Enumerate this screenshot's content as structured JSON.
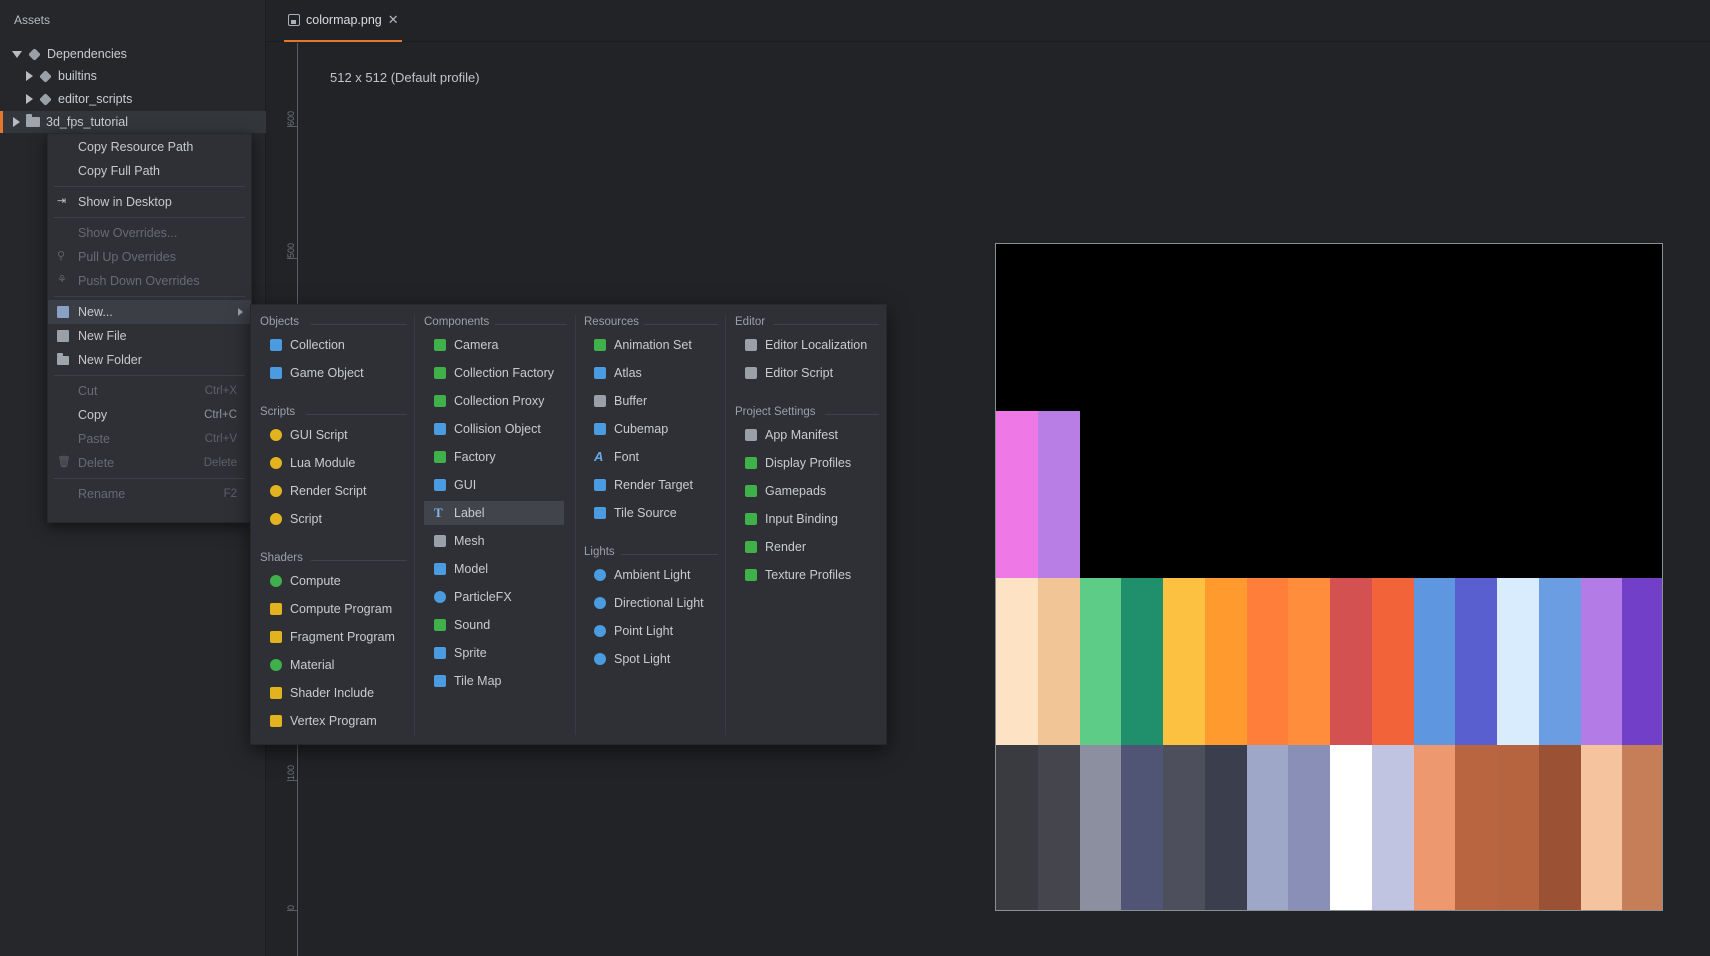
{
  "assets": {
    "title": "Assets",
    "tree": [
      {
        "label": "Dependencies",
        "level": 0,
        "expanded": true,
        "icon": "puzzle-icon"
      },
      {
        "label": "builtins",
        "level": 1,
        "expanded": false,
        "icon": "puzzle-icon"
      },
      {
        "label": "editor_scripts",
        "level": 1,
        "expanded": false,
        "icon": "puzzle-icon"
      },
      {
        "label": "3d_fps_tutorial",
        "level": 0,
        "expanded": false,
        "icon": "folder-icon",
        "selected": true
      }
    ]
  },
  "editor": {
    "tab_label": "colormap.png",
    "tab_close": "✕",
    "image_info": "512 x 512 (Default profile)",
    "ruler_labels": [
      "600",
      "500",
      "100",
      "0"
    ]
  },
  "context_menu": {
    "items": [
      {
        "label": "Copy Resource Path",
        "shortcut": "",
        "disabled": false
      },
      {
        "label": "Copy Full Path",
        "shortcut": "",
        "disabled": false
      },
      {
        "label": "Show in Desktop",
        "shortcut": "",
        "disabled": false
      },
      {
        "label": "Show Overrides...",
        "shortcut": "",
        "disabled": true
      },
      {
        "label": "Pull Up Overrides",
        "shortcut": "",
        "disabled": true
      },
      {
        "label": "Push Down Overrides",
        "shortcut": "",
        "disabled": true
      },
      {
        "label": "New...",
        "shortcut": "",
        "disabled": false,
        "active": true
      },
      {
        "label": "New File",
        "shortcut": "",
        "disabled": false
      },
      {
        "label": "New Folder",
        "shortcut": "",
        "disabled": false
      },
      {
        "label": "Cut",
        "shortcut": "Ctrl+X",
        "disabled": true
      },
      {
        "label": "Copy",
        "shortcut": "Ctrl+C",
        "disabled": false
      },
      {
        "label": "Paste",
        "shortcut": "Ctrl+V",
        "disabled": true
      },
      {
        "label": "Delete",
        "shortcut": "Delete",
        "disabled": true
      },
      {
        "label": "Rename",
        "shortcut": "F2",
        "disabled": true
      }
    ]
  },
  "submenu": {
    "objects": {
      "heading": "Objects",
      "items": [
        "Collection",
        "Game Object"
      ]
    },
    "scripts": {
      "heading": "Scripts",
      "items": [
        "GUI Script",
        "Lua Module",
        "Render Script",
        "Script"
      ]
    },
    "shaders": {
      "heading": "Shaders",
      "items": [
        "Compute",
        "Compute Program",
        "Fragment Program",
        "Material",
        "Shader Include",
        "Vertex Program"
      ]
    },
    "components": {
      "heading": "Components",
      "items": [
        "Camera",
        "Collection Factory",
        "Collection Proxy",
        "Collision Object",
        "Factory",
        "GUI",
        "Label",
        "Mesh",
        "Model",
        "ParticleFX",
        "Sound",
        "Sprite",
        "Tile Map"
      ]
    },
    "resources": {
      "heading": "Resources",
      "items": [
        "Animation Set",
        "Atlas",
        "Buffer",
        "Cubemap",
        "Font",
        "Render Target",
        "Tile Source"
      ]
    },
    "lights": {
      "heading": "Lights",
      "items": [
        "Ambient Light",
        "Directional Light",
        "Point Light",
        "Spot Light"
      ]
    },
    "editor": {
      "heading": "Editor",
      "items": [
        "Editor Localization",
        "Editor Script"
      ]
    },
    "project_settings": {
      "heading": "Project Settings",
      "items": [
        "App Manifest",
        "Display Profiles",
        "Gamepads",
        "Input Binding",
        "Render",
        "Texture Profiles"
      ]
    }
  },
  "colors": {
    "accent": "#e8772e",
    "background": "#222327",
    "panel": "#25272b",
    "menu": "#2e3035"
  },
  "colormap_rows": [
    [
      "#ee78e6",
      "#b87ee6"
    ],
    [
      "#fde2c3",
      "#f2c597",
      "#5dcc86",
      "#1f8f6c",
      "#fdc142",
      "#ff9a2e",
      "#ff7e3a",
      "#ff8d3b",
      "#d35150",
      "#f2633a",
      "#5e97e0",
      "#5a5fd0",
      "#d8ecfd",
      "#6b9de3",
      "#b27be6",
      "#7240c8"
    ],
    [
      "#3a3b41",
      "#45464d",
      "#8b8fa0",
      "#505575",
      "#4d4f5c",
      "#3b3e4d",
      "#9fa7c9",
      "#8a8fb8",
      "#ffffff",
      "#c0c4e0",
      "#ee9870",
      "#b86540",
      "#b5643f",
      "#9b5234",
      "#f5c39e",
      "#c67e58"
    ]
  ]
}
